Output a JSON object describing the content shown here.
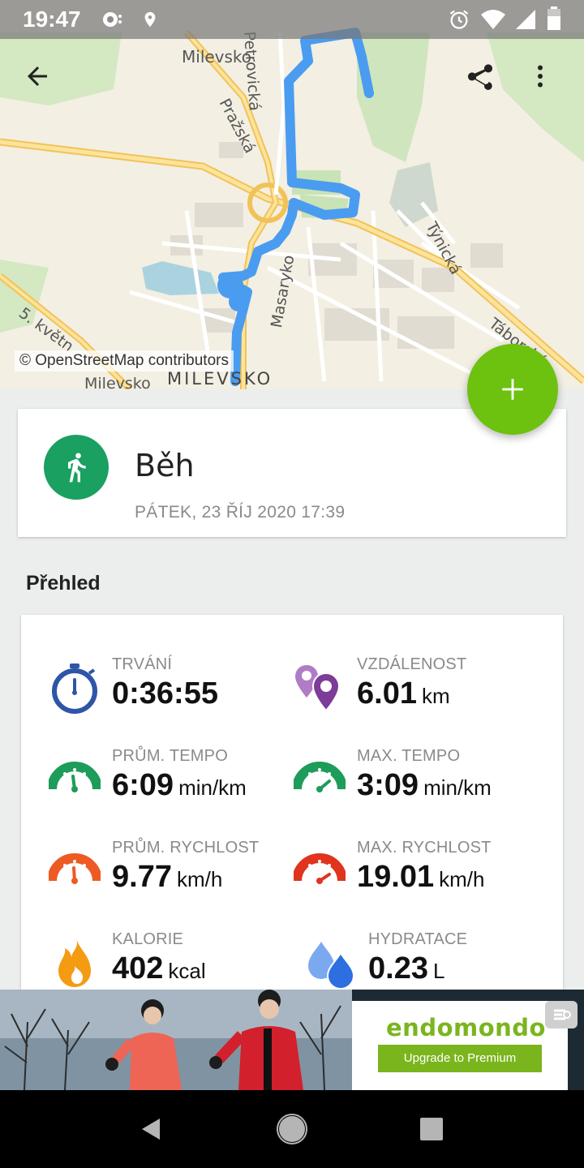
{
  "status_bar": {
    "time": "19:47",
    "icons": [
      "settings-notification-icon",
      "location-icon",
      "alarm-icon",
      "wifi-icon",
      "signal-icon",
      "battery-icon"
    ]
  },
  "map": {
    "attribution": "© OpenStreetMap contributors",
    "labels": {
      "milevsko_top": "Milevsko",
      "petrovicka": "Petrovická",
      "prazska": "Pražská",
      "tynicka": "Týnická",
      "masarykova": "Masaryko",
      "taborska": "Táborská",
      "s_kvetna": "5. květn",
      "milevsko_bottom": "Milevsko",
      "milevsko_caps": "MILEVSKO"
    },
    "route_color": "#4a9cf0"
  },
  "toolbar": {
    "icons": [
      "back-arrow-icon",
      "share-icon",
      "more-vert-icon"
    ]
  },
  "fab": {
    "icon": "plus-icon",
    "color": "#6cc20e"
  },
  "activity": {
    "title": "Běh",
    "date": "PÁTEK, 23 ŘÍJ 2020 17:39",
    "icon": "running-icon",
    "icon_color": "#1aa061"
  },
  "overview": {
    "title": "Přehled",
    "stats": [
      {
        "label": "TRVÁNÍ",
        "value": "0:36:55",
        "unit": "",
        "icon": "stopwatch-icon"
      },
      {
        "label": "VZDÁLENOST",
        "value": "6.01",
        "unit": "km",
        "icon": "location-pins-icon"
      },
      {
        "label": "PRŮM. TEMPO",
        "value": "6:09",
        "unit": "min/km",
        "icon": "speedometer-low-icon"
      },
      {
        "label": "MAX. TEMPO",
        "value": "3:09",
        "unit": "min/km",
        "icon": "speedometer-high-icon"
      },
      {
        "label": "PRŮM. RYCHLOST",
        "value": "9.77",
        "unit": "km/h",
        "icon": "gauge-low-icon"
      },
      {
        "label": "MAX. RYCHLOST",
        "value": "19.01",
        "unit": "km/h",
        "icon": "gauge-high-icon"
      },
      {
        "label": "KALORIE",
        "value": "402",
        "unit": "kcal",
        "icon": "flame-icon"
      },
      {
        "label": "HYDRATACE",
        "value": "0.23",
        "unit": "L",
        "icon": "water-drops-icon"
      }
    ]
  },
  "ad": {
    "brand": "endomondo",
    "button": "Upgrade to Premium"
  },
  "navbar": {
    "icons": [
      "back-triangle-icon",
      "home-circle-icon",
      "recents-square-icon"
    ]
  }
}
